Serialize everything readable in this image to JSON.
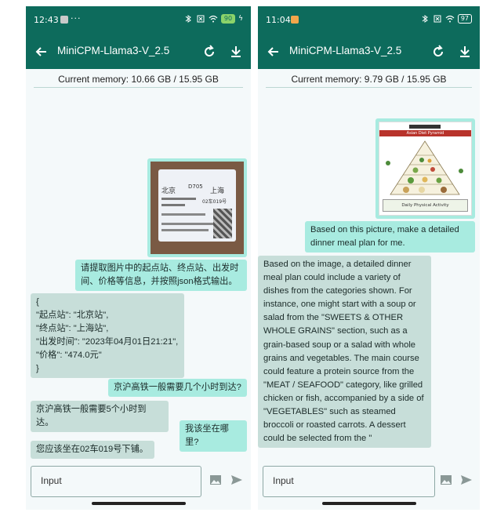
{
  "left": {
    "status": {
      "time": "12:43",
      "battery": "90"
    },
    "app": {
      "title": "MiniCPM-Llama3-V_2.5"
    },
    "memory": "Current memory: 10.66 GB / 15.95 GB",
    "ticket": {
      "number": "D705",
      "from": "北京",
      "to": "上海",
      "seat": "02车019号"
    },
    "messages": [
      {
        "role": "user",
        "text": "请提取图片中的起点站、终点站、出发时间、价格等信息，并按照json格式输出。"
      },
      {
        "role": "bot",
        "text": "{\n\"起点站\": \"北京站\",\n\"终点站\": \"上海站\",\n\"出发时间\": \"2023年04月01日21:21\",\n\"价格\": \"474.0元\"\n}"
      },
      {
        "role": "user",
        "text": "京沪高铁一般需要几个小时到达?"
      },
      {
        "role": "bot",
        "text": "京沪高铁一般需要5个小时到达。"
      },
      {
        "role": "user",
        "text": "我该坐在哪里?"
      },
      {
        "role": "bot",
        "text": "您应该坐在02车019号下铺。"
      }
    ],
    "input_placeholder": "Input"
  },
  "right": {
    "status": {
      "time": "11:04",
      "battery": "97"
    },
    "app": {
      "title": "MiniCPM-Llama3-V_2.5"
    },
    "memory": "Current memory: 9.79 GB / 15.95 GB",
    "pyramid": {
      "title": "Asian Diet Pyramid",
      "footer": "Daily Physical Activity"
    },
    "messages": [
      {
        "role": "user",
        "text": "Based on this picture, make a detailed dinner meal plan for me."
      },
      {
        "role": "bot",
        "text": "Based on the image, a detailed dinner meal plan could include a variety of dishes from the categories shown. For instance, one might start with a soup or salad from the \"SWEETS & OTHER WHOLE GRAINS\" section, such as a grain-based soup or a salad with whole grains and vegetables. The main course could feature a protein source from the \"MEAT / SEAFOOD\" category, like grilled chicken or fish, accompanied by a side of \"VEGETABLES\" such as steamed broccoli or roasted carrots. A dessert could be selected from the \""
      }
    ],
    "input_placeholder": "Input"
  },
  "colors": {
    "appbar": "#0d6b5c",
    "user_bubble": "#a8ebe0",
    "bot_bubble": "#c7ded9",
    "background": "#f4f9fa"
  }
}
